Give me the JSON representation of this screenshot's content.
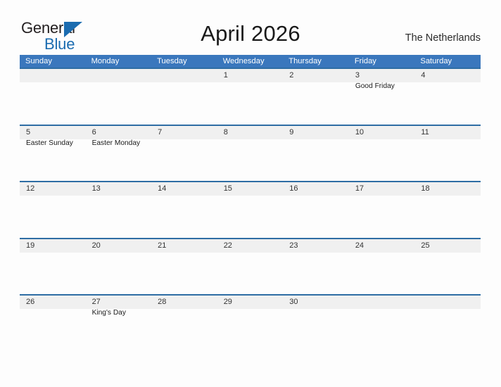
{
  "brand": {
    "name_part1": "General",
    "name_part2": "Blue",
    "flag_icon": "triangle-flag-icon",
    "color_dark": "#231f20",
    "color_blue": "#1b6cb0"
  },
  "header": {
    "title": "April 2026",
    "region": "The Netherlands"
  },
  "theme": {
    "header_bar": "#3a77bd",
    "row_divider": "#2e6da4",
    "band": "#f0f0f0",
    "page_bg": "#fdfdfd"
  },
  "calendar": {
    "weekdays": [
      "Sunday",
      "Monday",
      "Tuesday",
      "Wednesday",
      "Thursday",
      "Friday",
      "Saturday"
    ],
    "weeks": [
      [
        {
          "day": "",
          "event": ""
        },
        {
          "day": "",
          "event": ""
        },
        {
          "day": "",
          "event": ""
        },
        {
          "day": "1",
          "event": ""
        },
        {
          "day": "2",
          "event": ""
        },
        {
          "day": "3",
          "event": "Good Friday"
        },
        {
          "day": "4",
          "event": ""
        }
      ],
      [
        {
          "day": "5",
          "event": "Easter Sunday"
        },
        {
          "day": "6",
          "event": "Easter Monday"
        },
        {
          "day": "7",
          "event": ""
        },
        {
          "day": "8",
          "event": ""
        },
        {
          "day": "9",
          "event": ""
        },
        {
          "day": "10",
          "event": ""
        },
        {
          "day": "11",
          "event": ""
        }
      ],
      [
        {
          "day": "12",
          "event": ""
        },
        {
          "day": "13",
          "event": ""
        },
        {
          "day": "14",
          "event": ""
        },
        {
          "day": "15",
          "event": ""
        },
        {
          "day": "16",
          "event": ""
        },
        {
          "day": "17",
          "event": ""
        },
        {
          "day": "18",
          "event": ""
        }
      ],
      [
        {
          "day": "19",
          "event": ""
        },
        {
          "day": "20",
          "event": ""
        },
        {
          "day": "21",
          "event": ""
        },
        {
          "day": "22",
          "event": ""
        },
        {
          "day": "23",
          "event": ""
        },
        {
          "day": "24",
          "event": ""
        },
        {
          "day": "25",
          "event": ""
        }
      ],
      [
        {
          "day": "26",
          "event": ""
        },
        {
          "day": "27",
          "event": "King's Day"
        },
        {
          "day": "28",
          "event": ""
        },
        {
          "day": "29",
          "event": ""
        },
        {
          "day": "30",
          "event": ""
        },
        {
          "day": "",
          "event": ""
        },
        {
          "day": "",
          "event": ""
        }
      ]
    ]
  }
}
